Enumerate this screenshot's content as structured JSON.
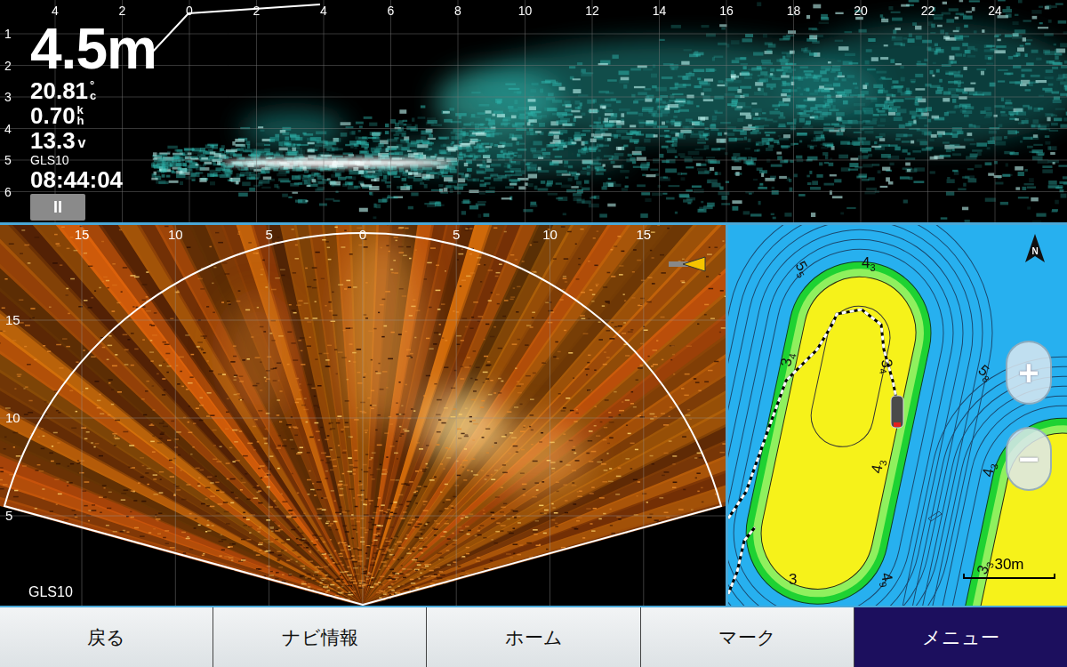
{
  "sonar_top": {
    "depth": "4.5",
    "depth_unit": "m",
    "temperature": "20.81",
    "temp_unit_top": "°",
    "temp_unit_bottom": "c",
    "speed": "0.70",
    "speed_unit_top": "k",
    "speed_unit_bottom": "h",
    "voltage": "13.3",
    "voltage_unit": "v",
    "source": "GLS10",
    "time": "08:44:04",
    "pause_button": "II",
    "x_ticks": [
      "4",
      "2",
      "0",
      "2",
      "4",
      "6",
      "8",
      "10",
      "12",
      "14",
      "16",
      "18",
      "20",
      "22",
      "24"
    ],
    "y_ticks": [
      "1",
      "2",
      "3",
      "4",
      "5",
      "6"
    ]
  },
  "sonar_fan": {
    "source": "GLS10",
    "x_ticks": [
      "15",
      "10",
      "5",
      "0",
      "5",
      "10",
      "15"
    ],
    "y_ticks": [
      "15",
      "10",
      "5"
    ]
  },
  "map": {
    "north": "N",
    "zoom_in": "+",
    "zoom_out": "−",
    "scale": "30m",
    "depth_labels": [
      {
        "main": "5",
        "sub": "5"
      },
      {
        "main": "4",
        "sub": "3"
      },
      {
        "main": "3",
        "sub": "4"
      },
      {
        "main": "3",
        "sub": "4"
      },
      {
        "main": "5",
        "sub": "8"
      },
      {
        "main": "4",
        "sub": "3"
      },
      {
        "main": "4",
        "sub": "3"
      },
      {
        "main": "3",
        "sub": ""
      },
      {
        "main": "4",
        "sub": "9"
      },
      {
        "main": "3",
        "sub": "3"
      }
    ]
  },
  "buttons": [
    {
      "label": "戻る",
      "selected": false
    },
    {
      "label": "ナビ情報",
      "selected": false
    },
    {
      "label": "ホーム",
      "selected": false
    },
    {
      "label": "マーク",
      "selected": false
    },
    {
      "label": "メニュー",
      "selected": true
    }
  ]
}
